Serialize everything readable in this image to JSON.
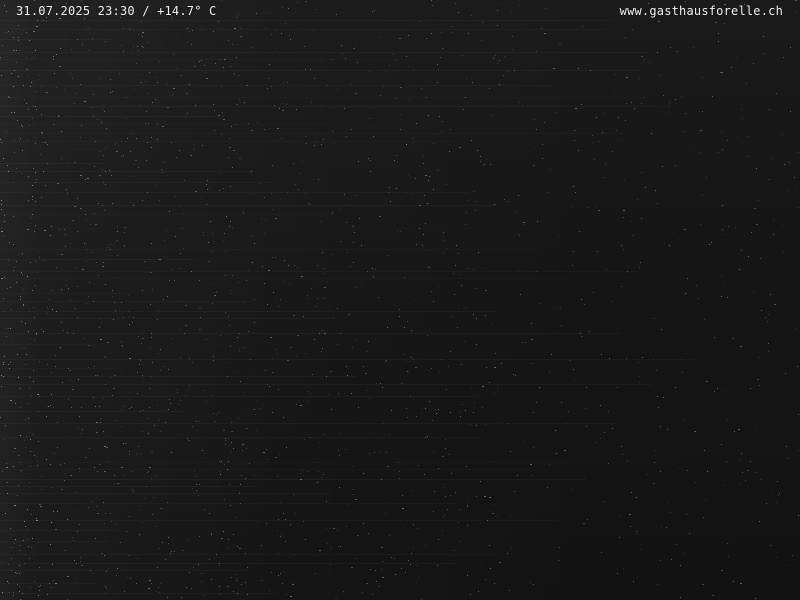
{
  "webcam": {
    "timestamp_text": "31.07.2025 23:30 / +14.7° C",
    "website_text": "www.gasthausforelle.ch",
    "scene_colors": {
      "background": "#121212",
      "noise_light": "#d9d9d9",
      "text": "#f2f2f2"
    }
  }
}
